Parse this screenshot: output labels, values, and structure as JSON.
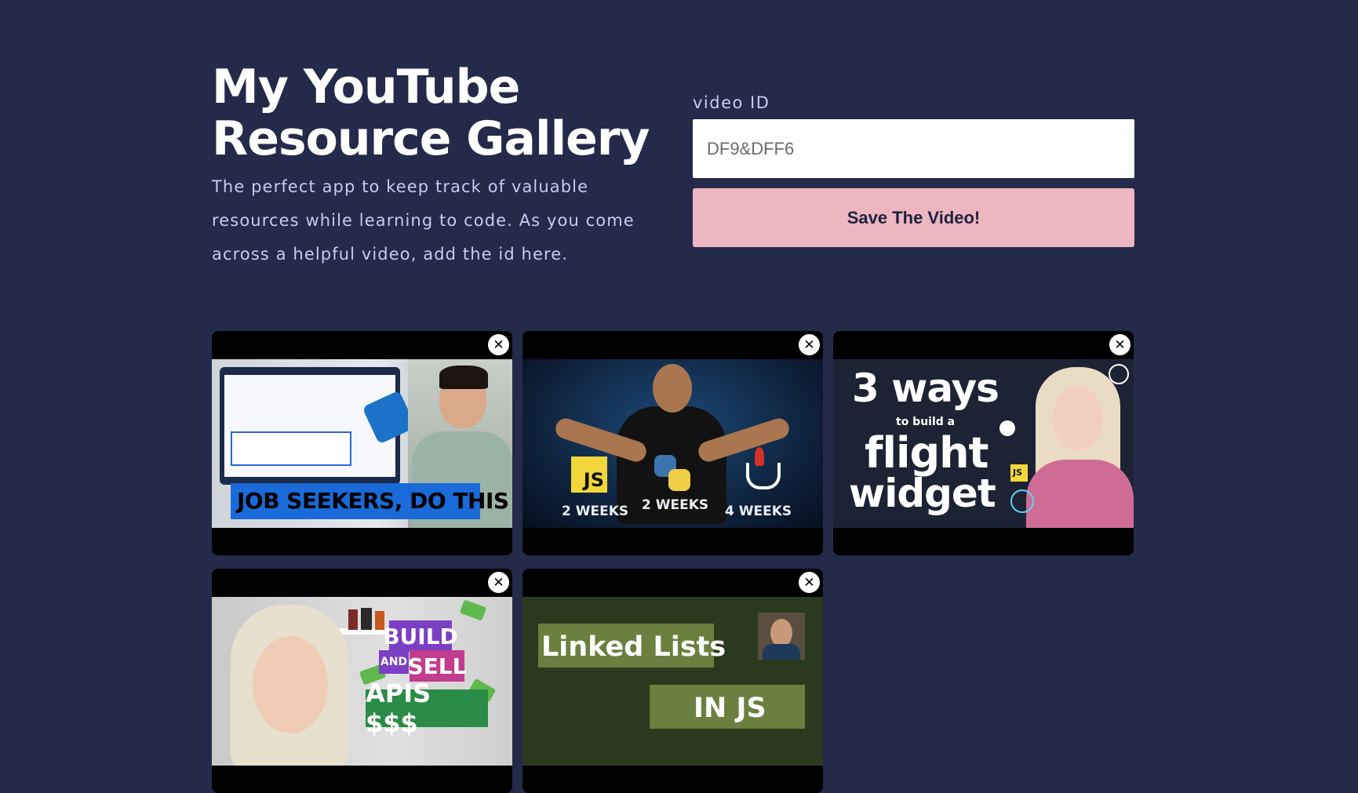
{
  "header": {
    "title": "My YouTube Resource Gallery",
    "description": "The perfect app to keep track of valuable resources while learning to code. As you come across a helpful video, add the id here."
  },
  "form": {
    "label": "video ID",
    "placeholder": "DF9&DFF6",
    "value": "",
    "submit_label": "Save The Video!"
  },
  "gallery": {
    "close_glyph": "✕",
    "videos": [
      {
        "thumb_text": [
          "JOB SEEKERS, DO THIS"
        ]
      },
      {
        "thumb_text": [
          "JS",
          "2 WEEKS",
          "2 WEEKS",
          "4 WEEKS"
        ]
      },
      {
        "thumb_text": [
          "3 ways",
          "to build a",
          "flight",
          "widget",
          "JS"
        ]
      },
      {
        "thumb_text": [
          "BUILD",
          "AND",
          "SELL",
          "APIS $$$"
        ]
      },
      {
        "thumb_text": [
          "Linked Lists",
          "IN JS"
        ]
      }
    ]
  },
  "colors": {
    "background": "#25294a",
    "button": "#edb6c0",
    "label_text": "#c3cdf4",
    "card_bg": "#000000"
  }
}
